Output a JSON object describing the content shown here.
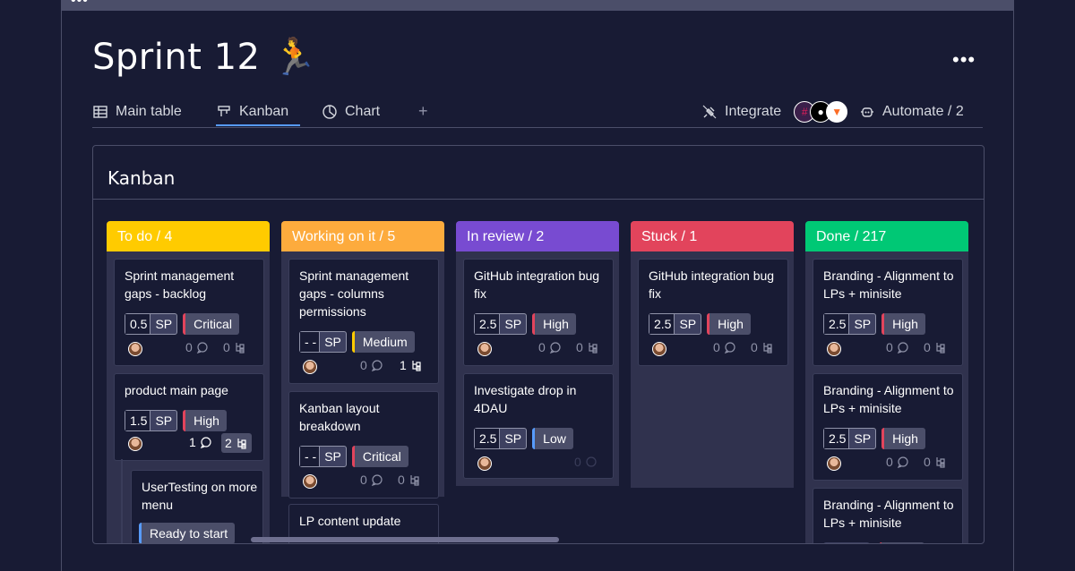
{
  "window": {
    "dots": "•••"
  },
  "board": {
    "title": "Sprint 12 🏃",
    "more": "•••"
  },
  "tabs": [
    {
      "label": "Main table",
      "icon": "table-icon"
    },
    {
      "label": "Kanban",
      "icon": "kanban-icon",
      "active": true
    },
    {
      "label": "Chart",
      "icon": "chart-icon"
    }
  ],
  "add_view": "+",
  "integrate": {
    "label": "Integrate",
    "logos": [
      "slack-logo",
      "github-logo",
      "gitlab-logo"
    ]
  },
  "automate": {
    "label": "Automate / 2"
  },
  "panel": {
    "title": "Kanban"
  },
  "columns": [
    {
      "title": "To do / 4",
      "color": "#ffcb00",
      "cards": [
        {
          "name": "Sprint management gaps - backlog",
          "sp": "0.5",
          "sp_unit": "SP",
          "priority": "Critical",
          "priority_color": "#e2445c",
          "updates": "0",
          "subitems": "0"
        },
        {
          "name": "product main page",
          "sp": "1.5",
          "sp_unit": "SP",
          "priority": "High",
          "priority_color": "#e2445c",
          "updates": "1",
          "subitems": "2"
        },
        {
          "name": "UserTesting on more menu",
          "status": "Ready to start",
          "status_color": "#579bfc"
        }
      ]
    },
    {
      "title": "Working on it / 5",
      "color": "#fdab3d",
      "cards": [
        {
          "name": "Sprint management gaps - columns permissions",
          "sp": "- -",
          "sp_unit": "SP",
          "priority": "Medium",
          "priority_color": "#ffcb00",
          "updates": "0",
          "subitems": "1"
        },
        {
          "name": "Kanban layout breakdown",
          "sp": "- -",
          "sp_unit": "SP",
          "priority": "Critical",
          "priority_color": "#e2445c",
          "updates": "0",
          "subitems": "0"
        },
        {
          "name": "LP content update"
        }
      ]
    },
    {
      "title": "In review / 2",
      "color": "#784bd1",
      "cards": [
        {
          "name": "GitHub integration bug fix",
          "sp": "2.5",
          "sp_unit": "SP",
          "priority": "High",
          "priority_color": "#e2445c",
          "updates": "0",
          "subitems": "0"
        },
        {
          "name": "Investigate drop in 4DAU",
          "sp": "2.5",
          "sp_unit": "SP",
          "priority": "Low",
          "priority_color": "#579bfc",
          "updates": "0",
          "subitems": "0"
        }
      ]
    },
    {
      "title": "Stuck / 1",
      "color": "#e2445c",
      "cards": [
        {
          "name": "GitHub integration bug fix",
          "sp": "2.5",
          "sp_unit": "SP",
          "priority": "High",
          "priority_color": "#e2445c",
          "updates": "0",
          "subitems": "0"
        }
      ]
    },
    {
      "title": "Done  / 217",
      "color": "#00c875",
      "cards": [
        {
          "name": "Branding  - Alignment to LPs + minisite",
          "sp": "2.5",
          "sp_unit": "SP",
          "priority": "High",
          "priority_color": "#e2445c",
          "updates": "0",
          "subitems": "0"
        },
        {
          "name": "Branding  - Alignment to LPs + minisite",
          "sp": "2.5",
          "sp_unit": "SP",
          "priority": "High",
          "priority_color": "#e2445c",
          "updates": "0",
          "subitems": "0"
        },
        {
          "name": "Branding  - Alignment to LPs + minisite"
        }
      ]
    }
  ]
}
